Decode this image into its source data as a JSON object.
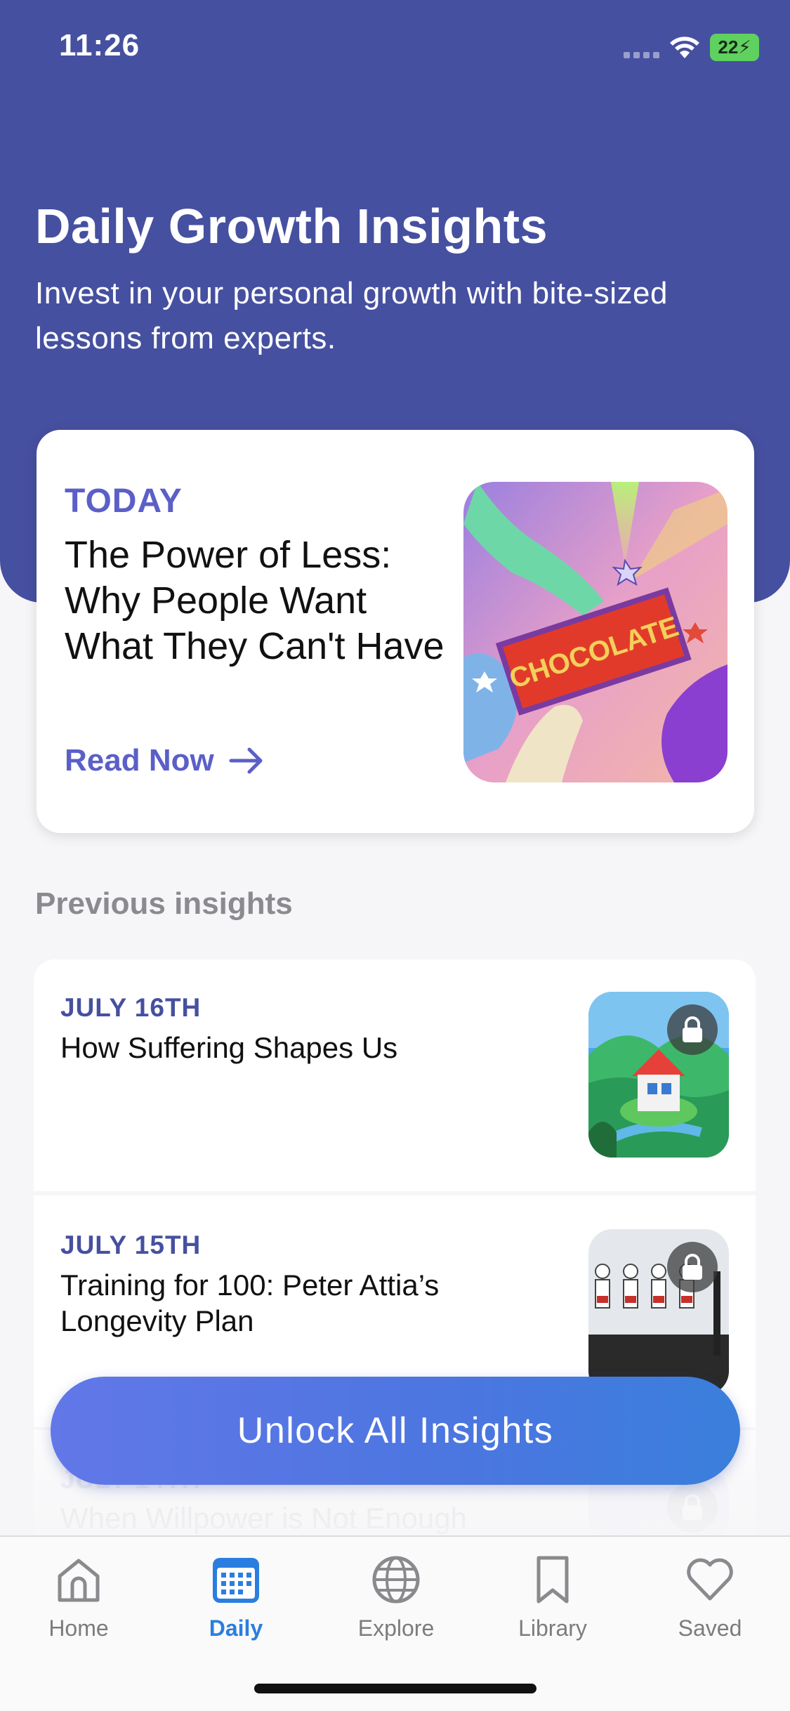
{
  "status_bar": {
    "time": "11:26",
    "battery": "22"
  },
  "header": {
    "title": "Daily Growth Insights",
    "subtitle": "Invest in your personal growth with bite-sized lessons from experts."
  },
  "today": {
    "label": "TODAY",
    "title": "The Power of Less: Why People Want What They Can't Have",
    "cta": "Read Now",
    "image_text": "CHOCOLATE"
  },
  "previous": {
    "heading": "Previous insights",
    "items": [
      {
        "date": "JULY 16TH",
        "title": "How Suffering Shapes Us",
        "locked": true
      },
      {
        "date": "JULY 15TH",
        "title": "Training for 100: Peter Attia’s Longevity Plan",
        "locked": true
      },
      {
        "date": "JULY 14TH",
        "title": "When Willpower is Not Enough",
        "locked": true
      }
    ]
  },
  "unlock_button": "Unlock All Insights",
  "tabs": [
    {
      "label": "Home",
      "icon": "home-icon",
      "active": false
    },
    {
      "label": "Daily",
      "icon": "calendar-icon",
      "active": true
    },
    {
      "label": "Explore",
      "icon": "globe-icon",
      "active": false
    },
    {
      "label": "Library",
      "icon": "bookmark-icon",
      "active": false
    },
    {
      "label": "Saved",
      "icon": "heart-icon",
      "active": false
    }
  ],
  "colors": {
    "header_bg": "#4650a0",
    "accent": "#5b5fc7",
    "tab_active": "#2a7ee0",
    "battery": "#5fd15f"
  }
}
